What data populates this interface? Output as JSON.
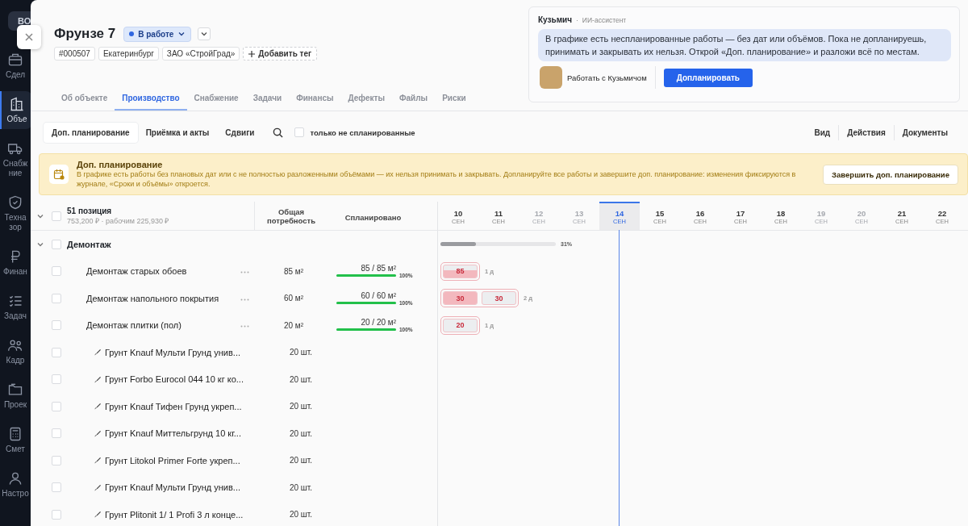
{
  "sidebar": {
    "logo": "ВО",
    "items": [
      {
        "label": "Сдел",
        "selected": false
      },
      {
        "label": "Объе",
        "selected": true
      },
      {
        "label": "Снабж ние",
        "selected": false
      },
      {
        "label": "Техна зор",
        "selected": false
      },
      {
        "label": "Финан",
        "selected": false
      },
      {
        "label": "Задач",
        "selected": false
      },
      {
        "label": "Кадр",
        "selected": false
      },
      {
        "label": "Проек",
        "selected": false
      },
      {
        "label": "Смет",
        "selected": false
      },
      {
        "label": "Настро",
        "selected": false
      }
    ]
  },
  "header": {
    "title": "Фрунзе 7",
    "status": "В работе",
    "tags": [
      "#000507",
      "Екатеринбург",
      "ЗАО «СтройГрад»"
    ],
    "add_tag": "Добавить тег"
  },
  "tabs": [
    {
      "label": "Об объекте",
      "selected": false
    },
    {
      "label": "Производство",
      "selected": true
    },
    {
      "label": "Снабжение",
      "selected": false
    },
    {
      "label": "Задачи",
      "selected": false
    },
    {
      "label": "Финансы",
      "selected": false
    },
    {
      "label": "Дефекты",
      "selected": false
    },
    {
      "label": "Файлы",
      "selected": false
    },
    {
      "label": "Риски",
      "selected": false
    }
  ],
  "assistant": {
    "name": "Кузьмич",
    "separator": "·",
    "role": "ИИ-ассистент",
    "message": "В графике есть неспланированные работы — без дат или объёмов. Пока не допланируешь, принимать и закрывать их нельзя. Открой «Доп. планирование» и разложи всё по местам.",
    "work_with": "Работать с Кузьмичом",
    "action": "Допланировать"
  },
  "toolbar": {
    "modes": [
      {
        "label": "Доп. планирование",
        "selected": true
      },
      {
        "label": "Приёмка и акты",
        "selected": false
      },
      {
        "label": "Сдвиги",
        "selected": false
      }
    ],
    "filter": {
      "label": "только не спланированные",
      "checked": false
    },
    "menus": [
      "Вид",
      "Действия",
      "Документы"
    ]
  },
  "banner": {
    "title": "Доп. планирование",
    "text": "В графике есть работы без плановых дат или с не полностью разложенными объёмами — их нельзя принимать и закрывать. Допланируйте все работы и завершите доп. планирование: изменения фиксируются в журнале, «Сроки и объёмы» откроется.",
    "button": "Завершить доп. планирование"
  },
  "table": {
    "summary": {
      "count": "51 позиция",
      "subtitle": "753,200 ₽ · рабочим 225,930 ₽",
      "checked": false,
      "expanded": true
    },
    "columns": [
      "Общая потребность",
      "Спланировано"
    ],
    "days": [
      {
        "day": "10",
        "month": "СЕН",
        "weekend": false,
        "selected": false
      },
      {
        "day": "11",
        "month": "СЕН",
        "weekend": false,
        "selected": false
      },
      {
        "day": "12",
        "month": "СЕН",
        "weekend": true,
        "selected": false
      },
      {
        "day": "13",
        "month": "СЕН",
        "weekend": true,
        "selected": false
      },
      {
        "day": "14",
        "month": "СЕН",
        "weekend": false,
        "selected": true
      },
      {
        "day": "15",
        "month": "СЕН",
        "weekend": false,
        "selected": false
      },
      {
        "day": "16",
        "month": "СЕН",
        "weekend": false,
        "selected": false
      },
      {
        "day": "17",
        "month": "СЕН",
        "weekend": false,
        "selected": false
      },
      {
        "day": "18",
        "month": "СЕН",
        "weekend": false,
        "selected": false
      },
      {
        "day": "19",
        "month": "СЕН",
        "weekend": true,
        "selected": false
      },
      {
        "day": "20",
        "month": "СЕН",
        "weekend": true,
        "selected": false
      },
      {
        "day": "21",
        "month": "СЕН",
        "weekend": false,
        "selected": false
      },
      {
        "day": "22",
        "month": "СЕН",
        "weekend": false,
        "selected": false
      }
    ],
    "rows": [
      {
        "kind": "group",
        "name": "Демонтаж",
        "checked": false,
        "expanded": true,
        "level": 0.31,
        "percent": "31%",
        "children": [
          {
            "kind": "work",
            "name": "Демонтаж старых обоев",
            "checked": false,
            "need": "85 м²",
            "planned": "85 / 85 м²",
            "level": 1,
            "percent": "100%",
            "chips": [
              {
                "value": "85",
                "kind": "partial"
              }
            ],
            "duration": "1 д"
          },
          {
            "kind": "work",
            "name": "Демонтаж напольного покрытия",
            "checked": false,
            "need": "60 м²",
            "planned": "60 / 60 м²",
            "level": 1,
            "percent": "100%",
            "chips": [
              {
                "value": "30",
                "kind": "full"
              },
              {
                "value": "30",
                "kind": "empty"
              }
            ],
            "duration": "2 д"
          },
          {
            "kind": "work",
            "name": "Демонтаж плитки (пол)",
            "checked": false,
            "need": "20 м²",
            "planned": "20 / 20 м²",
            "level": 1,
            "percent": "100%",
            "chips": [
              {
                "value": "20",
                "kind": "empty"
              }
            ],
            "duration": "1 д",
            "children": [
              {
                "kind": "material",
                "name": "Грунт Knauf Мульти Грунд унив...",
                "checked": false,
                "need": "20 шт."
              },
              {
                "kind": "material",
                "name": "Грунт Forbo Eurocol 044 10 кг ко...",
                "checked": false,
                "need": "20 шт."
              },
              {
                "kind": "material",
                "name": "Грунт Knauf Тифен Грунд укреп...",
                "checked": false,
                "need": "20 шт."
              },
              {
                "kind": "material",
                "name": "Грунт Knauf Миттельгрунд 10 кг...",
                "checked": false,
                "need": "20 шт."
              },
              {
                "kind": "material",
                "name": "Грунт Litokol Primer Forte укреп...",
                "checked": false,
                "need": "20 шт."
              },
              {
                "kind": "material",
                "name": "Грунт Knauf Мульти Грунд унив...",
                "checked": false,
                "need": "20 шт."
              },
              {
                "kind": "material",
                "name": "Грунт Plitonit 1/ 1 Profi 3 л конце...",
                "checked": false,
                "need": "20 шт."
              }
            ]
          }
        ]
      }
    ]
  }
}
